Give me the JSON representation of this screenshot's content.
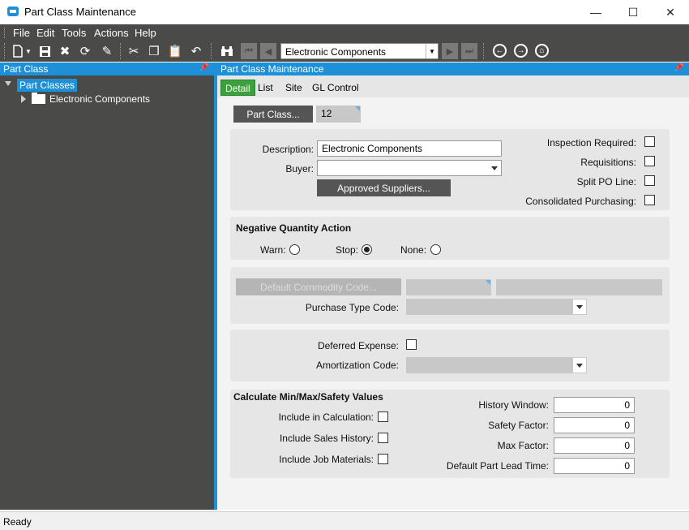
{
  "window": {
    "title": "Part Class Maintenance",
    "min": "—",
    "max": "☐",
    "close": "✕"
  },
  "menu": [
    "File",
    "Edit",
    "Tools",
    "Actions",
    "Help"
  ],
  "toolbar": {
    "nav_value": "Electronic Components"
  },
  "left_pane": {
    "header": "Part Class",
    "tree": {
      "root": "Part Classes",
      "children": [
        "Electronic Components"
      ]
    }
  },
  "right_pane": {
    "header": "Part Class Maintenance",
    "tabs": [
      "Detail",
      "List",
      "Site",
      "GL Control"
    ],
    "active_tab": "Detail"
  },
  "detail": {
    "part_class_button": "Part Class...",
    "part_class_value": "12",
    "description_label": "Description:",
    "description_value": "Electronic Components",
    "buyer_label": "Buyer:",
    "buyer_value": "",
    "approved_suppliers_button": "Approved Suppliers...",
    "inspection_required_label": "Inspection Required:",
    "requisitions_label": "Requisitions:",
    "split_po_line_label": "Split PO Line:",
    "consolidated_purchasing_label": "Consolidated Purchasing:",
    "negative_qty": {
      "title": "Negative Quantity Action",
      "warn_label": "Warn:",
      "stop_label": "Stop:",
      "none_label": "None:",
      "selected": "Stop"
    },
    "default_commodity_code_button": "Default Commodity Code...",
    "purchase_type_code_label": "Purchase Type Code:",
    "deferred_expense_label": "Deferred Expense:",
    "amortization_code_label": "Amortization Code:",
    "calc": {
      "title": "Calculate Min/Max/Safety Values",
      "include_calc_label": "Include in Calculation:",
      "include_sales_label": "Include Sales History:",
      "include_job_label": "Include Job Materials:",
      "history_window_label": "History Window:",
      "history_window_value": "0",
      "safety_factor_label": "Safety Factor:",
      "safety_factor_value": "0",
      "max_factor_label": "Max Factor:",
      "max_factor_value": "0",
      "lead_time_label": "Default Part Lead Time:",
      "lead_time_value": "0"
    }
  },
  "status": {
    "text": "Ready"
  },
  "colors": {
    "accent": "#1e90d8",
    "dark": "#4a4a48",
    "tab_active": "#3ca03c"
  }
}
